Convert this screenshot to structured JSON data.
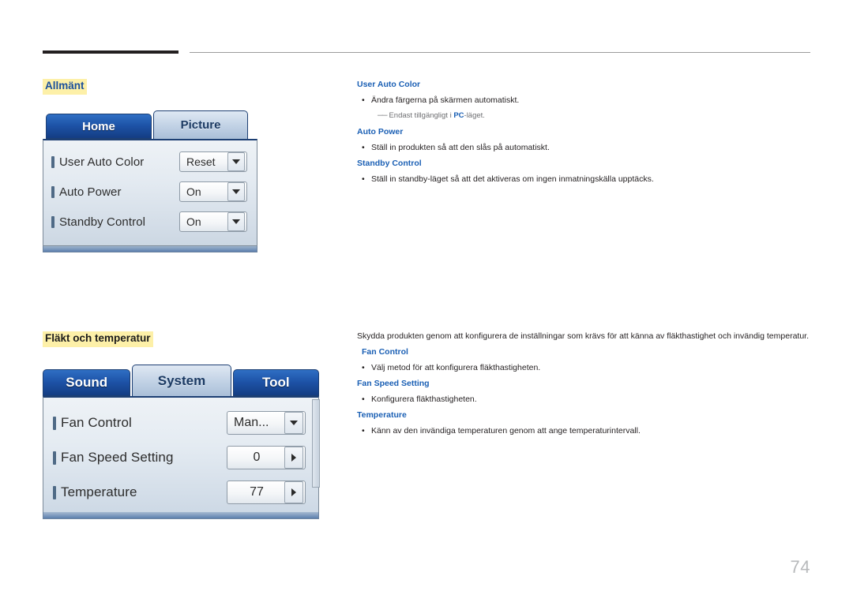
{
  "page": {
    "number": "74"
  },
  "sections": {
    "general": {
      "title": "Allmänt",
      "osd": {
        "tabs": [
          {
            "label": "Home",
            "active": false
          },
          {
            "label": "Picture",
            "active": true
          }
        ],
        "rows": [
          {
            "label": "User Auto Color",
            "value": "Reset",
            "control": "dropdown"
          },
          {
            "label": "Auto Power",
            "value": "On",
            "control": "dropdown"
          },
          {
            "label": "Standby Control",
            "value": "On",
            "control": "dropdown"
          }
        ]
      },
      "items": [
        {
          "heading": "User Auto Color",
          "bullet": "Ändra färgerna på skärmen automatiskt.",
          "note_prefix": "Endast tillgängligt i ",
          "note_bold": "PC",
          "note_suffix": "-läget."
        },
        {
          "heading": "Auto Power",
          "bullet": "Ställ in produkten så att den slås på automatiskt."
        },
        {
          "heading": "Standby Control",
          "bullet": "Ställ in standby-läget så att det aktiveras om ingen inmatningskälla upptäcks."
        }
      ]
    },
    "fan": {
      "title": "Fläkt och temperatur",
      "intro": "Skydda produkten genom att konfigurera de inställningar som krävs för att känna av fläkthastighet och invändig temperatur.",
      "osd": {
        "tabs": [
          {
            "label": "Sound",
            "active": false
          },
          {
            "label": "System",
            "active": true
          },
          {
            "label": "Tool",
            "active": false
          }
        ],
        "rows": [
          {
            "label": "Fan Control",
            "value": "Man...",
            "control": "dropdown"
          },
          {
            "label": "Fan Speed Setting",
            "value": "0",
            "control": "stepper"
          },
          {
            "label": "Temperature",
            "value": "77",
            "control": "stepper"
          }
        ]
      },
      "items": [
        {
          "heading": "Fan Control",
          "bullet": "Välj metod för att konfigurera fläkthastigheten."
        },
        {
          "heading": "Fan Speed Setting",
          "bullet": "Konfigurera fläkthastigheten."
        },
        {
          "heading": "Temperature",
          "bullet": "Känn av den invändiga temperaturen genom att ange temperaturintervall."
        }
      ]
    }
  }
}
